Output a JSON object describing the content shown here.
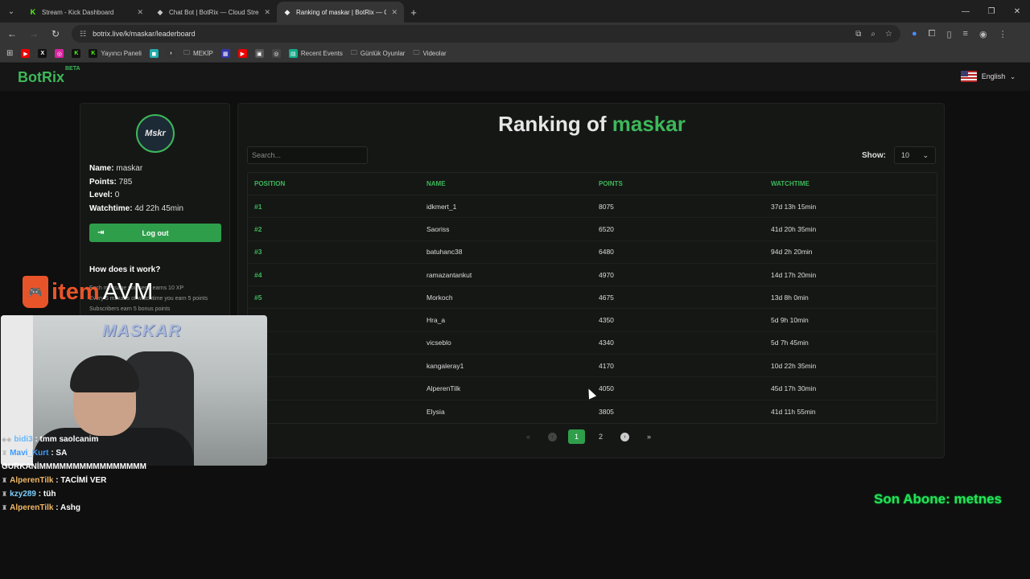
{
  "browser": {
    "tabs": [
      {
        "title": "Stream - Kick Dashboard",
        "icon": "kick-icon",
        "active": false
      },
      {
        "title": "Chat Bot | BotRix — Cloud Strea",
        "icon": "botrix-icon",
        "active": false
      },
      {
        "title": "Ranking of maskar | BotRix — C",
        "icon": "botrix-icon",
        "active": true
      }
    ],
    "url": "botrix.live/k/maskar/leaderboard",
    "bookmarks": [
      {
        "label": "",
        "icon": "youtube-icon"
      },
      {
        "label": "",
        "icon": "x-icon"
      },
      {
        "label": "",
        "icon": "instagram-icon"
      },
      {
        "label": "",
        "icon": "kick-icon"
      },
      {
        "label": "Yayıncı Paneli",
        "icon": "kick-icon"
      },
      {
        "label": "",
        "icon": "app-icon"
      },
      {
        "label": "",
        "icon": "play-icon"
      },
      {
        "label": "MEKİP",
        "icon": "folder-icon"
      },
      {
        "label": "",
        "icon": "app-icon"
      },
      {
        "label": "",
        "icon": "youtube-icon"
      },
      {
        "label": "",
        "icon": "image-icon"
      },
      {
        "label": "",
        "icon": "app-icon"
      },
      {
        "label": "Recent Events",
        "icon": "app-icon"
      },
      {
        "label": "Günlük Oyunlar",
        "icon": "folder-icon"
      },
      {
        "label": "Videolar",
        "icon": "folder-icon"
      }
    ]
  },
  "site": {
    "logo": "BotRix",
    "logo_badge": "BETA",
    "language": "English"
  },
  "profile": {
    "avatar_text": "Mskr",
    "name_label": "Name:",
    "name": "maskar",
    "points_label": "Points:",
    "points": "785",
    "level_label": "Level:",
    "level": "0",
    "watchtime_label": "Watchtime:",
    "watchtime": "4d 22h 45min",
    "logout_label": "Log out",
    "how_title": "How does it work?",
    "how_lines": [
      "Each message you send earns 10 XP",
      "Every 5 minutes of watchtime you earn 5 points",
      "Subscribers earn 5 bonus points"
    ]
  },
  "leaderboard": {
    "title_prefix": "Ranking of",
    "title_user": "maskar",
    "search_placeholder": "Search...",
    "show_label": "Show:",
    "show_value": "10",
    "columns": [
      "Position",
      "Name",
      "Points",
      "Watchtime"
    ],
    "rows": [
      {
        "pos": "#1",
        "name": "idkmert_1",
        "points": "8075",
        "watchtime": "37d 13h 15min"
      },
      {
        "pos": "#2",
        "name": "Saoriss",
        "points": "6520",
        "watchtime": "41d 20h 35min"
      },
      {
        "pos": "#3",
        "name": "batuhanc38",
        "points": "6480",
        "watchtime": "94d 2h 20min"
      },
      {
        "pos": "#4",
        "name": "ramazantankut",
        "points": "4970",
        "watchtime": "14d 17h 20min"
      },
      {
        "pos": "#5",
        "name": "Morkoch",
        "points": "4675",
        "watchtime": "13d 8h 0min"
      },
      {
        "pos": "",
        "name": "Hra_a",
        "points": "4350",
        "watchtime": "5d 9h 10min"
      },
      {
        "pos": "",
        "name": "vicseblo",
        "points": "4340",
        "watchtime": "5d 7h 45min"
      },
      {
        "pos": "",
        "name": "kangaleray1",
        "points": "4170",
        "watchtime": "10d 22h 35min"
      },
      {
        "pos": "",
        "name": "AlperenTilk",
        "points": "4050",
        "watchtime": "45d 17h 30min"
      },
      {
        "pos": "",
        "name": "Elysia",
        "points": "3805",
        "watchtime": "41d 11h 55min"
      }
    ],
    "pager": {
      "first": "«",
      "prev": "‹",
      "page1": "1",
      "page2": "2",
      "next": "›",
      "last": "»"
    }
  },
  "overlay": {
    "sponsor_a": "item",
    "sponsor_b": "AVM",
    "cam_text": "MASKAR",
    "chat": [
      {
        "user": "bidi3",
        "msg": ": tmm saolcanim",
        "color": "#66b8ff"
      },
      {
        "user": "Mavi_Kurt",
        "msg": ": SA",
        "color": "#3d9bff"
      },
      {
        "user": "",
        "msg": "GURKANİMMMMMMMMMMMMMMMM",
        "color": "#ffffff"
      },
      {
        "user": "AlperenTilk",
        "msg": ": TACİMİ VER",
        "color": "#f2b866"
      },
      {
        "user": "kzy289",
        "msg": ": tüh",
        "color": "#7fd0ff"
      },
      {
        "user": "AlperenTilk",
        "msg": ": Ashg",
        "color": "#f2b866"
      }
    ],
    "last_sub": "Son Abone: metnes"
  },
  "colors": {
    "accent": "#3db85a",
    "button": "#2f9e4b",
    "bg": "#0e0f0e",
    "card": "#151715"
  }
}
